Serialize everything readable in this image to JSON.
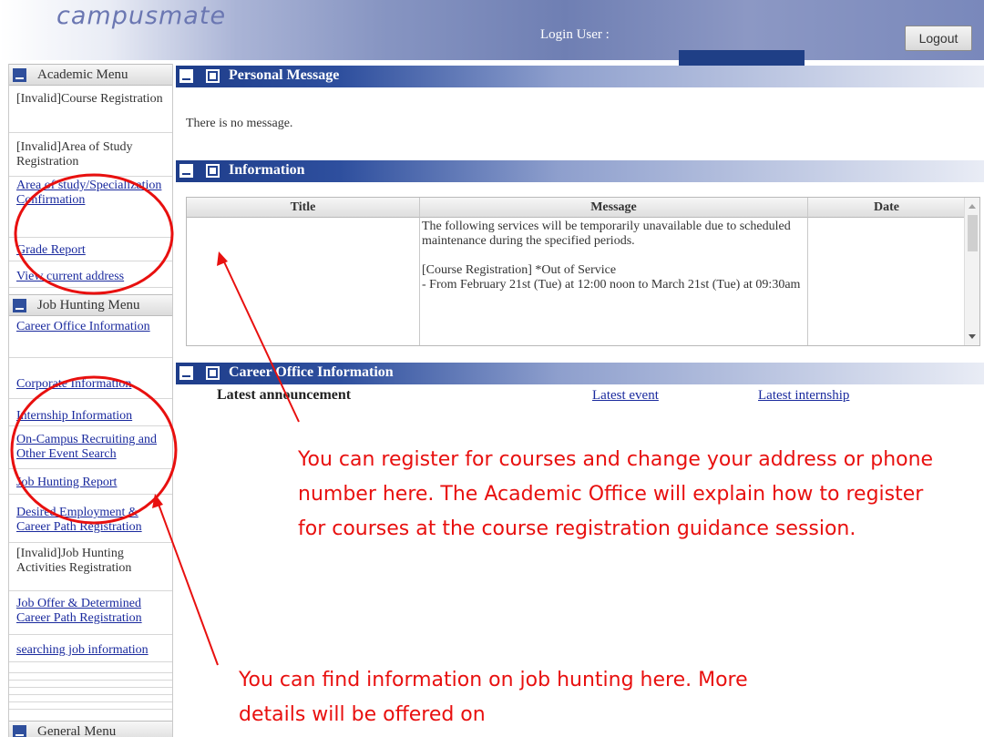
{
  "header": {
    "logo": "campusmate",
    "login_label": "Login User :",
    "logout_label": "Logout"
  },
  "sidebar": {
    "academic_menu_title": "Academic Menu",
    "academic_items": [
      "[Invalid]Course Registration",
      "[Invalid]Area of Study Registration",
      "Area of study/Specialization Confirmation",
      "Grade Report",
      "View current address"
    ],
    "job_menu_title": "Job Hunting Menu",
    "job_items": [
      "Career Office Information",
      "Corporate Information",
      "Internship Information",
      "On-Campus Recruiting and Other Event Search",
      "Job Hunting Report",
      "Desired Employment & Career Path Registration",
      "[Invalid]Job Hunting Activities Registration",
      "Job Offer & Determined Career Path Registration",
      "searching job information"
    ],
    "general_menu_title": "General Menu"
  },
  "personal_message": {
    "title": "Personal Message",
    "text": "There is no message."
  },
  "information": {
    "title": "Information",
    "columns": [
      "Title",
      "Message",
      "Date"
    ],
    "message_lines": [
      "The following services will be temporarily unavailable due to scheduled maintenance during the specified periods.",
      "[Course Registration] *Out of Service",
      "- From February 21st (Tue) at 12:00 noon to March 21st (Tue) at 09:30am"
    ]
  },
  "career_office": {
    "title": "Career Office Information",
    "latest_announcement": "Latest announcement",
    "latest_event": "Latest event",
    "latest_internship": "Latest internship"
  },
  "annotations": {
    "academic_note": "You can register for courses and change your address or phone number here. The Academic Office will explain how to register for courses at the course registration guidance session.",
    "job_note": "You can find information on job hunting here. More details will be offered on",
    "color": "#e8100f"
  },
  "colors": {
    "header_blue": "#1e3d8a",
    "link_blue": "#1a2a9e",
    "user_bar": "#1f3f86"
  }
}
